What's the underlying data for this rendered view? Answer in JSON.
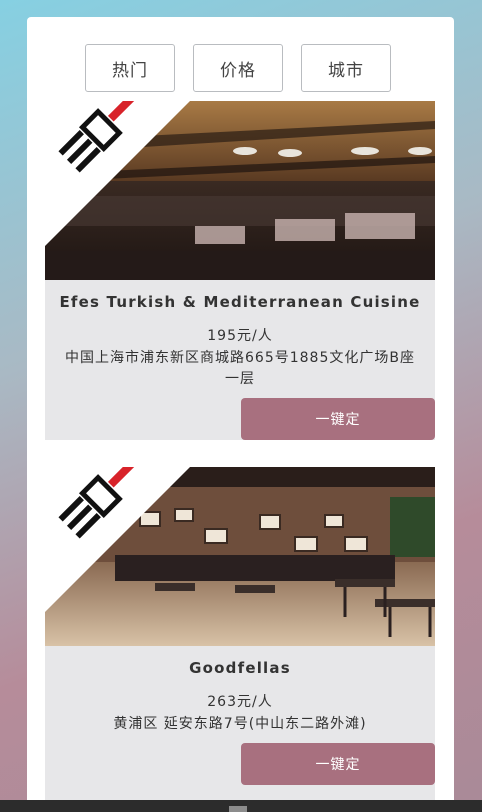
{
  "filters": [
    {
      "label": "热门"
    },
    {
      "label": "价格"
    },
    {
      "label": "城市"
    }
  ],
  "restaurants": [
    {
      "name": "Efes Turkish & Mediterranean Cuisine",
      "price": "195元/人",
      "address": "中国上海市浦东新区商城路665号1885文化广场B座一层",
      "book_label": "一键定",
      "badge": "三免一"
    },
    {
      "name": "Goodfellas",
      "price": "263元/人",
      "address": "黄浦区 延安东路7号(中山东二路外滩)",
      "book_label": "一键定",
      "badge": "三免一"
    }
  ],
  "colors": {
    "accent": "#a8707f",
    "card_bg": "#e7e7e9",
    "badge_red": "#d8232a"
  }
}
